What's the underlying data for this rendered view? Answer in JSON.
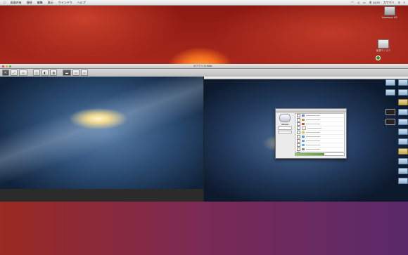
{
  "menubar": {
    "apple": "",
    "items": [
      "画面共有",
      "接続",
      "編集",
      "表示",
      "ウインドウ",
      "ヘルプ"
    ],
    "clock": "木 14:23",
    "user": "カワウソ"
  },
  "desktop": {
    "hd_label": "Macintosh HD",
    "drive_label": "仮想ディスク"
  },
  "vm_window": {
    "title": "カワウソ の iMac"
  },
  "inner_screen": {
    "icloud_label": "iCloud"
  },
  "colors": {
    "accent_green": "#2a9a3a",
    "traffic_red": "#e0443a",
    "traffic_yellow": "#e0b030",
    "traffic_green": "#50b040"
  }
}
